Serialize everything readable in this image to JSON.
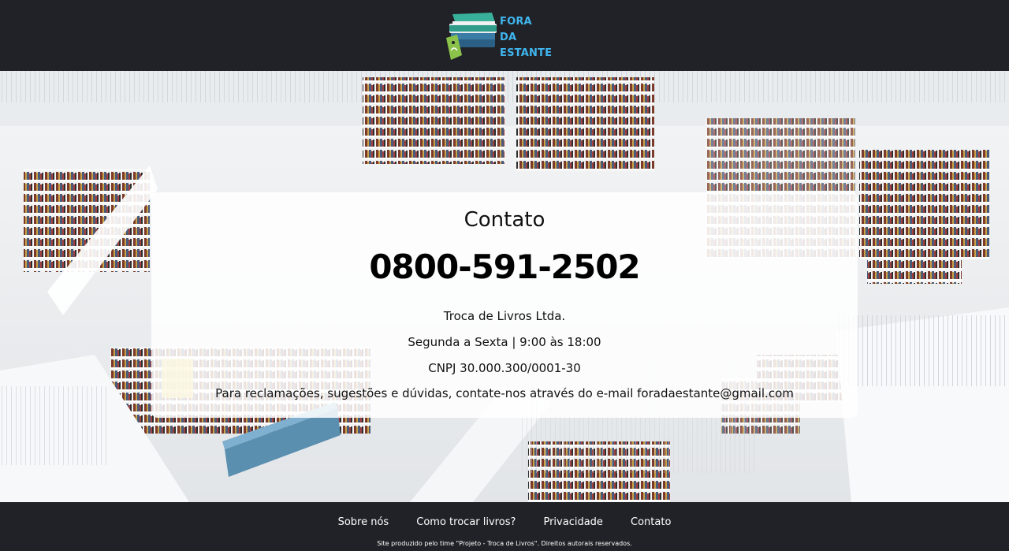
{
  "header": {
    "logo_line1": "FORA",
    "logo_line2": "DA ESTANTE"
  },
  "contact": {
    "title": "Contato",
    "phone": "0800-591-2502",
    "company": "Troca de Livros Ltda.",
    "hours": "Segunda a Sexta | 9:00 às 18:00",
    "cnpj": "CNPJ 30.000.300/0001-30",
    "message": "Para reclamações, sugestões e dúvidas, contate-nos através do e-mail foradaestante@gmail.com"
  },
  "footer": {
    "links": [
      "Sobre nós",
      "Como trocar livros?",
      "Privacidade",
      "Contato"
    ],
    "copyright": "Site produzido pelo time \"Projeto - Troca de Livros\". Direitos autorais reservados."
  },
  "colors": {
    "dark_bg": "#212228",
    "logo_blue": "#3fb6ee",
    "logo_teal": "#2f9d8a",
    "logo_green": "#8bc34a"
  }
}
